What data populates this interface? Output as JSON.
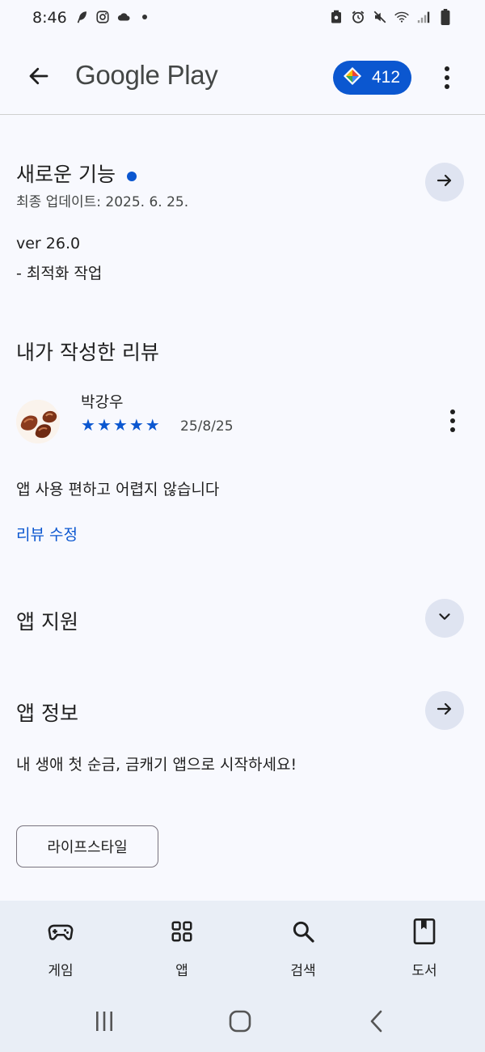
{
  "status_bar": {
    "time": "8:46",
    "left_icons": [
      "feather-icon",
      "instagram-icon",
      "cloud-icon",
      "dot-icon"
    ],
    "right_icons": [
      "recycle-icon",
      "alarm-icon",
      "mute-icon",
      "wifi-icon",
      "signal-icon",
      "battery-icon"
    ]
  },
  "app_bar": {
    "brand": "Google Play",
    "points": "412"
  },
  "whats_new": {
    "title": "새로운 기능",
    "updated": "최종 업데이트: 2025. 6. 25.",
    "version": "ver 26.0",
    "note": "- 최적화 작업"
  },
  "my_review": {
    "title": "내가 작성한 리뷰",
    "author": "박강우",
    "rating": 5,
    "date": "25/8/25",
    "text": "앱 사용 편하고 어렵지 않습니다",
    "edit_label": "리뷰 수정"
  },
  "app_support": {
    "title": "앱 지원"
  },
  "app_info": {
    "title": "앱 정보",
    "description": "내 생애 첫 순금, 금캐기 앱으로 시작하세요!",
    "category": "라이프스타일"
  },
  "bottom_nav": {
    "items": [
      {
        "label": "게임",
        "icon": "gamepad-icon"
      },
      {
        "label": "앱",
        "icon": "apps-grid-icon"
      },
      {
        "label": "검색",
        "icon": "search-icon"
      },
      {
        "label": "도서",
        "icon": "book-icon"
      }
    ]
  },
  "colors": {
    "accent": "#0b57d0",
    "background": "#f8f9fe",
    "nav_background": "#e9eef6",
    "circle_button": "#dfe4f1"
  }
}
